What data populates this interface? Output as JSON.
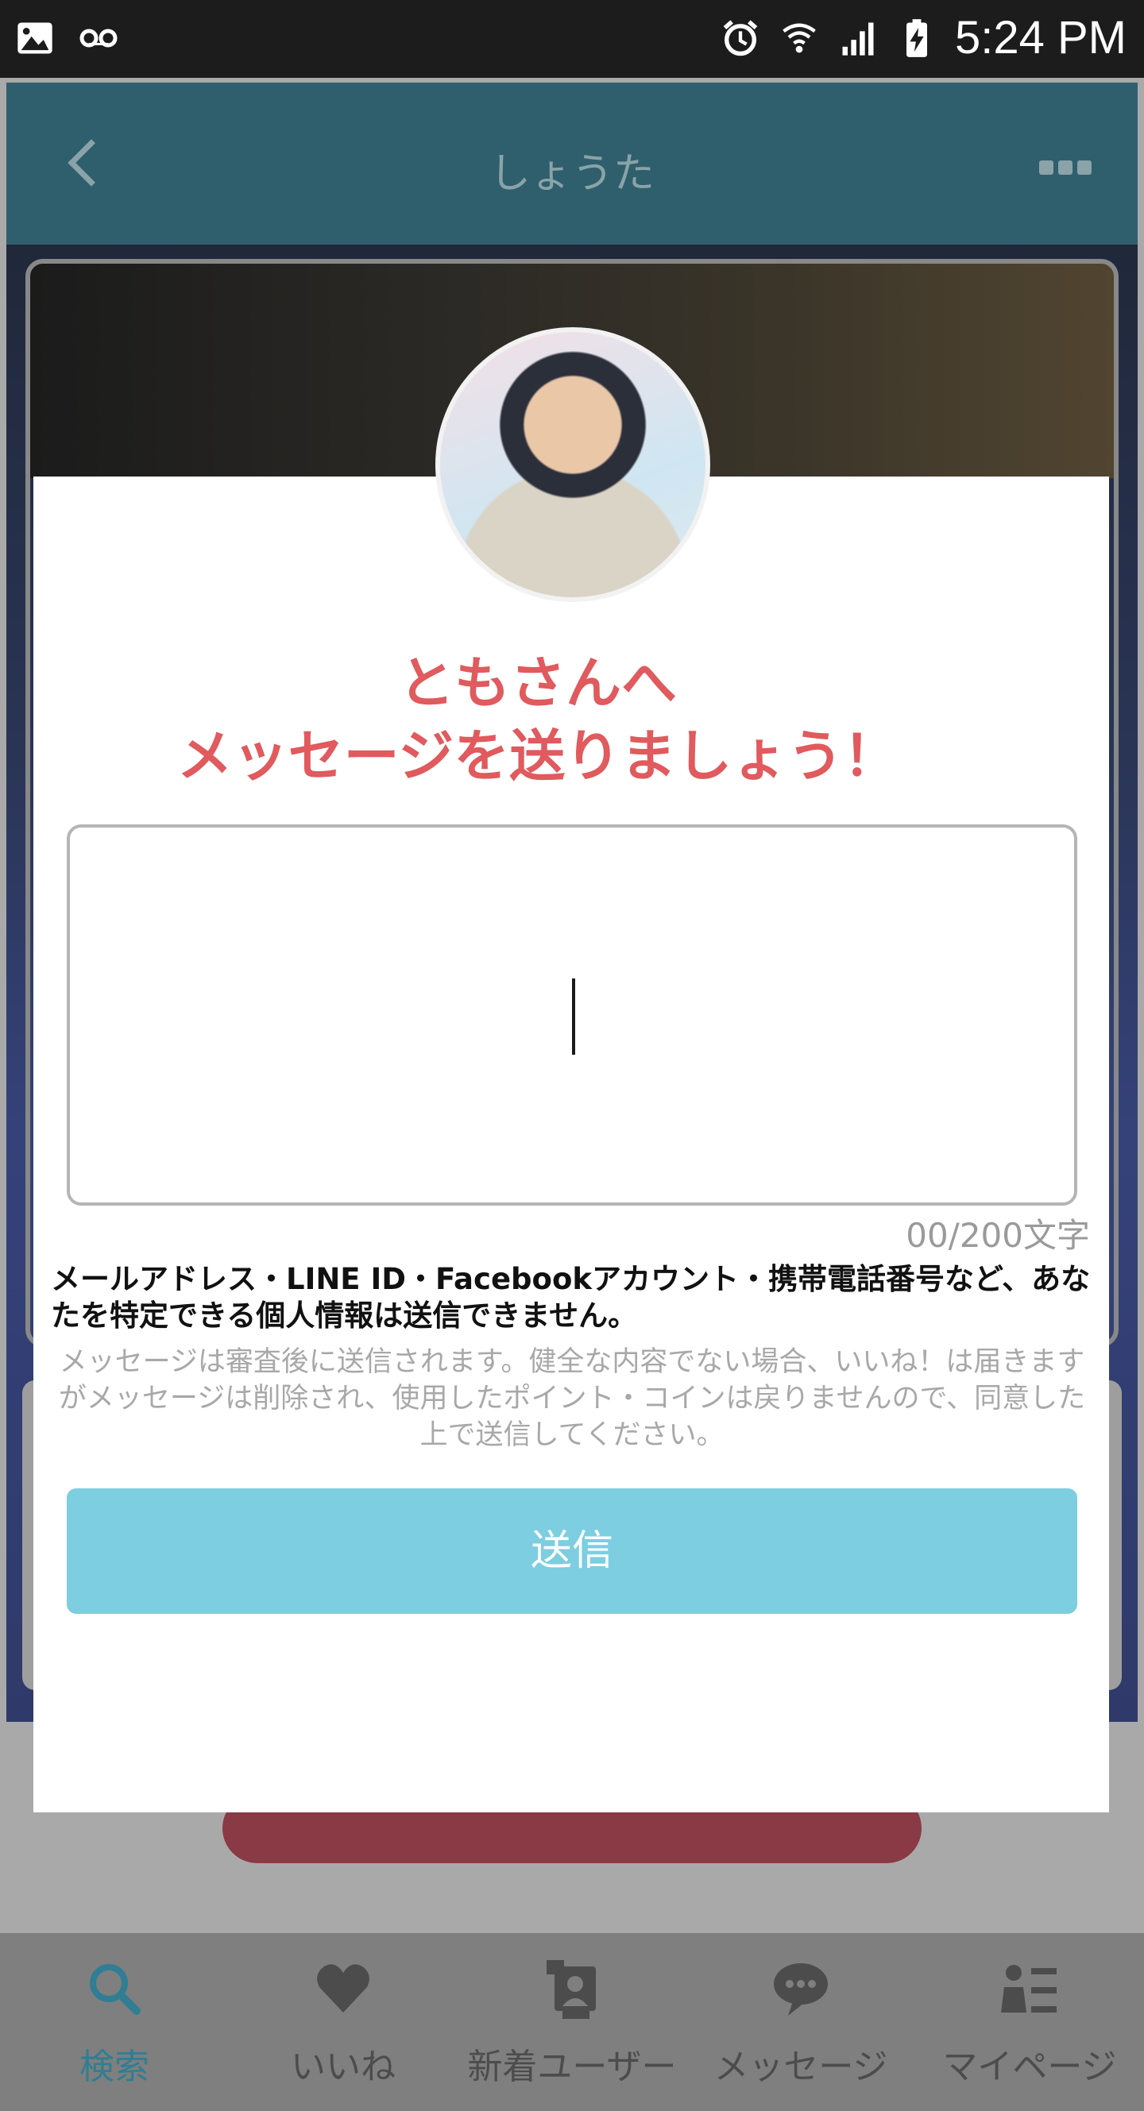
{
  "status_bar": {
    "time": "5:24 PM"
  },
  "header": {
    "title": "しょうた"
  },
  "bottom_nav": [
    {
      "label": "検索",
      "icon": "search-icon",
      "active": true
    },
    {
      "label": "いいね",
      "icon": "heart-icon",
      "active": false
    },
    {
      "label": "新着ユーザー",
      "icon": "new-user-icon",
      "active": false
    },
    {
      "label": "メッセージ",
      "icon": "chat-bubble-icon",
      "active": false
    },
    {
      "label": "マイページ",
      "icon": "profile-list-icon",
      "active": false
    }
  ],
  "modal": {
    "title_line1": "ともさんへ",
    "title_line2": "メッセージを送りましょう！",
    "message_value": "",
    "counter": "00/200文字",
    "warning": "メールアドレス・LINE ID・Facebookアカウント・携帯電話番号など、あなたを特定できる個人情報は送信できません。",
    "note": "メッセージは審査後に送信されます。健全な内容でない場合、いいね！は届きますがメッセージは削除され、使用したポイント・コインは戻りませんので、同意した上で送信してください。",
    "send_label": "送信"
  },
  "colors": {
    "accent_red": "#e05a5e",
    "send_button": "#7ccee0",
    "nav_active": "#2f7e93"
  }
}
